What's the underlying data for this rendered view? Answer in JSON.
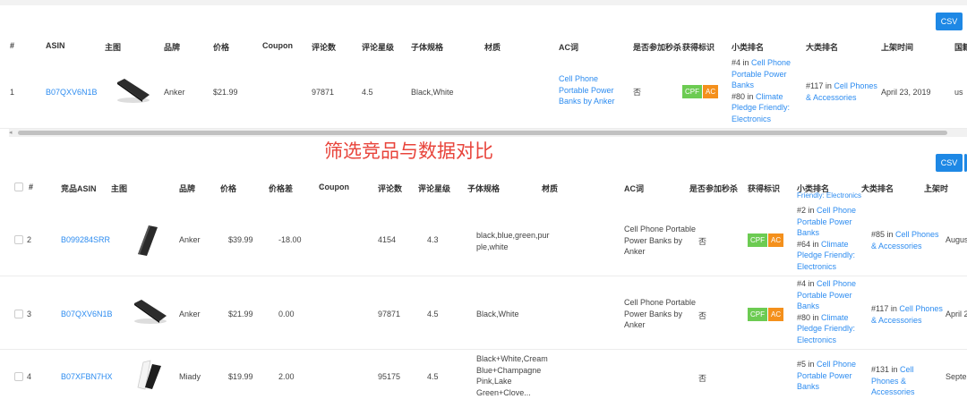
{
  "top_table": {
    "csv_label": "CSV",
    "headers": [
      "#",
      "ASIN",
      "主图",
      "品牌",
      "价格",
      "Coupon",
      "评论数",
      "评论星级",
      "子体规格",
      "材质",
      "AC词",
      "是否参加秒杀",
      "获得标识",
      "小类排名",
      "大类排名",
      "上架时间",
      "国籍"
    ],
    "row": {
      "index": "1",
      "asin": "B07QXV6N1B",
      "brand": "Anker",
      "price": "$21.99",
      "reviews": "97871",
      "stars": "4.5",
      "spec": "Black,White",
      "ac_word": "Cell Phone Portable Power Banks by Anker",
      "flash_sale": "否",
      "badge_cpf": "CPF",
      "badge_ac": "AC",
      "sub_rank": {
        "r1": "#4 in ",
        "l1": "Cell Phone Portable Power Banks",
        "r2": "#80 in ",
        "l2": "Climate Pledge Friendly: Electronics"
      },
      "main_rank": {
        "r": "#117 in ",
        "l": "Cell Phones & Accessories"
      },
      "date": "April 23, 2019",
      "country": "us"
    }
  },
  "compare_title": "筛选竞品与数据对比",
  "bottom_table": {
    "csv_label": "CSV",
    "headers": {
      "index": "#",
      "asin": "竞品ASIN",
      "image": "主图",
      "brand": "品牌",
      "price": "价格",
      "price_diff": "价格差",
      "coupon": "Coupon",
      "reviews": "评论数",
      "stars": "评论星级",
      "spec": "子体规格",
      "material": "材质",
      "ac_word": "AC词",
      "flash_sale": "是否参加秒杀",
      "badge": "获得标识",
      "sub_rank": "小类排名",
      "main_rank": "大类排名",
      "date": "上架时"
    },
    "partial_top_text": "Friendly: Electronics",
    "rows": [
      {
        "index": "2",
        "asin": "B099284SRR",
        "brand": "Anker",
        "price": "$39.99",
        "price_diff": "-18.00",
        "reviews": "4154",
        "stars": "4.3",
        "spec": "black,blue,green,pur ple,white",
        "ac_word": "Cell Phone Portable Power Banks by Anker",
        "flash_sale": "否",
        "badge_cpf": "CPF",
        "badge_ac": "AC",
        "sub_r1": "#2 in ",
        "sub_l1": "Cell Phone Portable Power Banks",
        "sub_r2": "#64 in ",
        "sub_l2": "Climate Pledge Friendly: Electronics",
        "main_r": "#85 in ",
        "main_l": "Cell Phones & Accessories",
        "date": "August"
      },
      {
        "index": "3",
        "asin": "B07QXV6N1B",
        "brand": "Anker",
        "price": "$21.99",
        "price_diff": "0.00",
        "reviews": "97871",
        "stars": "4.5",
        "spec": "Black,White",
        "ac_word": "Cell Phone Portable Power Banks by Anker",
        "flash_sale": "否",
        "badge_cpf": "CPF",
        "badge_ac": "AC",
        "sub_r1": "#4 in ",
        "sub_l1": "Cell Phone Portable Power Banks",
        "sub_r2": "#80 in ",
        "sub_l2": "Climate Pledge Friendly: Electronics",
        "main_r": "#117 in ",
        "main_l": "Cell Phones & Accessories",
        "date": "April 2"
      },
      {
        "index": "4",
        "asin": "B07XFBN7HX",
        "brand": "Miady",
        "price": "$19.99",
        "price_diff": "2.00",
        "reviews": "95175",
        "stars": "4.5",
        "spec": "Black+White,Cream Blue+Champagne Pink,Lake Green+Clove...",
        "ac_word": "",
        "flash_sale": "否",
        "sub_r1": "#5 in ",
        "sub_l1": "Cell Phone Portable Power Banks",
        "main_r": "#131 in ",
        "main_l": "Cell Phones & Accessories",
        "date": "Septer"
      }
    ]
  },
  "colors": {
    "link": "#2d8cf0",
    "csv": "#1e88e5",
    "cpf": "#6ccb52",
    "ac": "#f4901c",
    "title_red": "#e8443b"
  }
}
